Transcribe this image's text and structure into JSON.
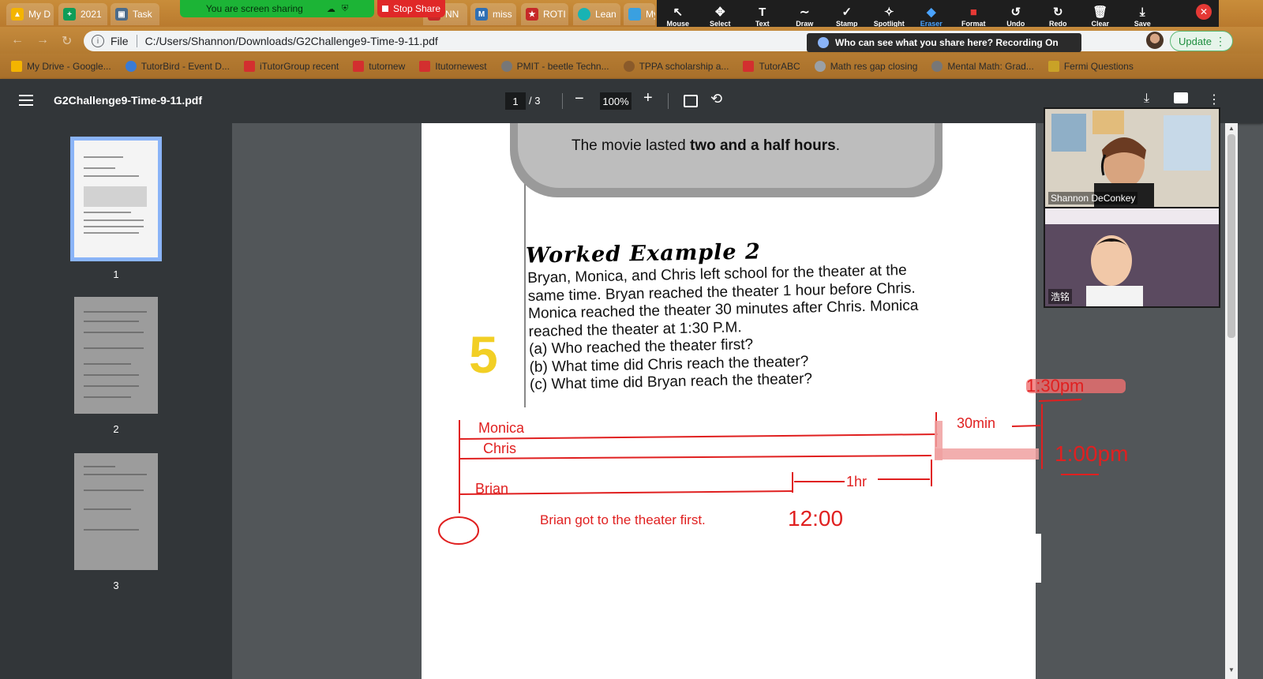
{
  "tabs": [
    {
      "label": "My D",
      "color": "#f4b400"
    },
    {
      "label": "2021",
      "color": "#0f9d58"
    },
    {
      "label": "Task",
      "color": "#4b6b8a"
    },
    {
      "label": "NN",
      "color": "#c62828"
    },
    {
      "label": "miss",
      "color": "#2f6fb3"
    },
    {
      "label": "ROTI",
      "color": "#c62828"
    },
    {
      "label": "Lean",
      "color": "#19b3b3"
    },
    {
      "label": "My",
      "color": "#3aa0e0"
    }
  ],
  "share": {
    "banner": "You are screen sharing",
    "stop_label": "Stop Share"
  },
  "annotation_tools": [
    {
      "label": "Mouse",
      "icon": "↖"
    },
    {
      "label": "Select",
      "icon": "✥"
    },
    {
      "label": "Text",
      "icon": "T"
    },
    {
      "label": "Draw",
      "icon": "∼"
    },
    {
      "label": "Stamp",
      "icon": "✓"
    },
    {
      "label": "Spotlight",
      "icon": "✧"
    },
    {
      "label": "Eraser",
      "icon": "◆",
      "active": true
    },
    {
      "label": "Format",
      "icon": "■"
    },
    {
      "label": "Undo",
      "icon": "↺"
    },
    {
      "label": "Redo",
      "icon": "↻"
    },
    {
      "label": "Clear",
      "icon": "🗑"
    },
    {
      "label": "Save",
      "icon": "⤓"
    }
  ],
  "addressbar": {
    "scheme_label": "File",
    "url": "C:/Users/Shannon/Downloads/G2Challenge9-Time-9-11.pdf",
    "recording_notice": "Who can see what you share here? Recording On",
    "update_label": "Update"
  },
  "bookmarks": [
    {
      "label": "My Drive - Google...",
      "color": "#f4b400"
    },
    {
      "label": "TutorBird - Event D...",
      "color": "#3a7bd5"
    },
    {
      "label": "iTutorGroup recent",
      "color": "#d32f2f"
    },
    {
      "label": "tutornew",
      "color": "#d32f2f"
    },
    {
      "label": "Itutornewest",
      "color": "#d32f2f"
    },
    {
      "label": "PMIT - beetle Techn...",
      "color": "#777777"
    },
    {
      "label": "TPPA scholarship a...",
      "color": "#8a5a2a"
    },
    {
      "label": "TutorABC",
      "color": "#d32f2f"
    },
    {
      "label": "Math res gap closing",
      "color": "#9aa0a6"
    },
    {
      "label": "Mental Math: Grad...",
      "color": "#777777"
    },
    {
      "label": "Fermi Questions",
      "color": "#c9a227"
    }
  ],
  "pdf": {
    "title": "G2Challenge9-Time-9-11.pdf",
    "current_page": "1",
    "total_pages": "/ 3",
    "zoom": "100%",
    "thumbnails": [
      "1",
      "2",
      "3"
    ]
  },
  "document": {
    "movie_prefix": "The movie lasted ",
    "movie_bold": "two and a half hours",
    "movie_suffix": ".",
    "heading": "Worked Example 2",
    "problem_number": "5",
    "problem_lines": [
      "Bryan, Monica, and Chris left school for the theater at the",
      "same time. Bryan reached the theater 1 hour before Chris.",
      "Monica reached the theater 30 minutes after Chris. Monica",
      "reached the theater at 1:30 P.M.",
      "(a) Who reached the theater first?",
      "(b) What time did Chris reach the theater?",
      "(c) What time did Bryan reach the theater?"
    ]
  },
  "annotations": {
    "monica": "Monica",
    "chris": "Chris",
    "brian": "Brian",
    "answer": "Brian got to the theater first.",
    "thirty_min": "30min",
    "one_hr": "1hr",
    "time_130": "1:30pm",
    "time_100": "1:00pm",
    "time_1200": "12:00",
    "ink_color": "#e02020"
  },
  "participants": [
    {
      "name": "Shannon DeConkey"
    },
    {
      "name": "浩铭"
    }
  ]
}
